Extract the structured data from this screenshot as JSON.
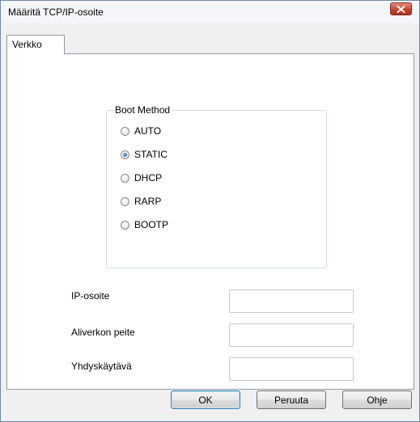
{
  "window": {
    "title": "Määritä TCP/IP-osoite"
  },
  "tabs": [
    {
      "label": "Verkko",
      "active": true
    }
  ],
  "boot_method": {
    "legend": "Boot Method",
    "options": [
      {
        "label": "AUTO",
        "checked": false
      },
      {
        "label": "STATIC",
        "checked": true
      },
      {
        "label": "DHCP",
        "checked": false
      },
      {
        "label": "RARP",
        "checked": false
      },
      {
        "label": "BOOTP",
        "checked": false
      }
    ]
  },
  "fields": [
    {
      "label": "IP-osoite",
      "value": ""
    },
    {
      "label": "Aliverkon peite",
      "value": ""
    },
    {
      "label": "Yhdyskäytävä",
      "value": ""
    }
  ],
  "buttons": {
    "ok": "OK",
    "cancel": "Peruuta",
    "help": "Ohje"
  },
  "colors": {
    "close_button": "#c8432b",
    "default_button_border": "#3c7fb1",
    "radio_selected": "#1f5fa8"
  },
  "icons": {
    "close": "close-icon"
  }
}
